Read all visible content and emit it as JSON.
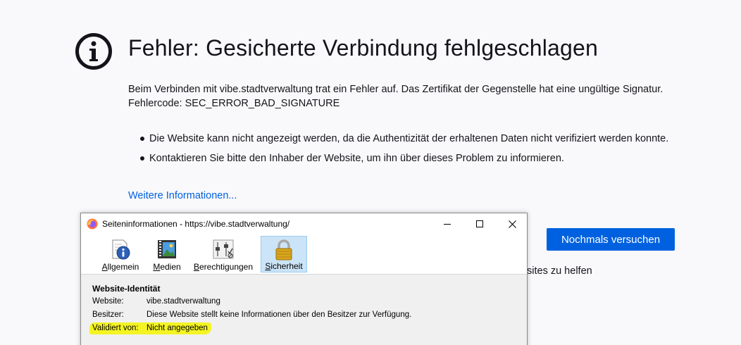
{
  "error_page": {
    "title": "Fehler: Gesicherte Verbindung fehlgeschlagen",
    "description": "Beim Verbinden mit vibe.stadtverwaltung trat ein Fehler auf. Das Zertifikat der Gegenstelle hat eine ungültige Signatur. Fehlercode: SEC_ERROR_BAD_SIGNATURE",
    "bullets": [
      "Die Website kann nicht angezeigt werden, da die Authentizität der erhaltenen Daten nicht verifiziert werden konnte.",
      "Kontaktieren Sie bitte den Inhaber der Website, um ihn über dieses Problem zu informieren."
    ],
    "more_info_link": "Weitere Informationen...",
    "retry_button": "Nochmals versuchen",
    "partially_hidden_text": "sites zu helfen"
  },
  "dialog": {
    "title": "Seiteninformationen - https://vibe.stadtverwaltung/",
    "tabs": [
      {
        "label": "Allgemein",
        "icon": "info-icon"
      },
      {
        "label": "Medien",
        "icon": "media-icon"
      },
      {
        "label": "Berechtigungen",
        "icon": "permissions-icon"
      },
      {
        "label": "Sicherheit",
        "icon": "lock-icon"
      }
    ],
    "active_tab": "Sicherheit",
    "section_heading": "Website-Identität",
    "fields": [
      {
        "key": "Website:",
        "value": "vibe.stadtverwaltung"
      },
      {
        "key": "Besitzer:",
        "value": "Diese Website stellt keine Informationen über den Besitzer zur Verfügung."
      },
      {
        "key": "Validiert von:",
        "value": "Nicht angegeben"
      }
    ],
    "highlight_color": "#f4f500"
  },
  "colors": {
    "accent": "#0061e0",
    "page_background": "#f9f9fb"
  }
}
